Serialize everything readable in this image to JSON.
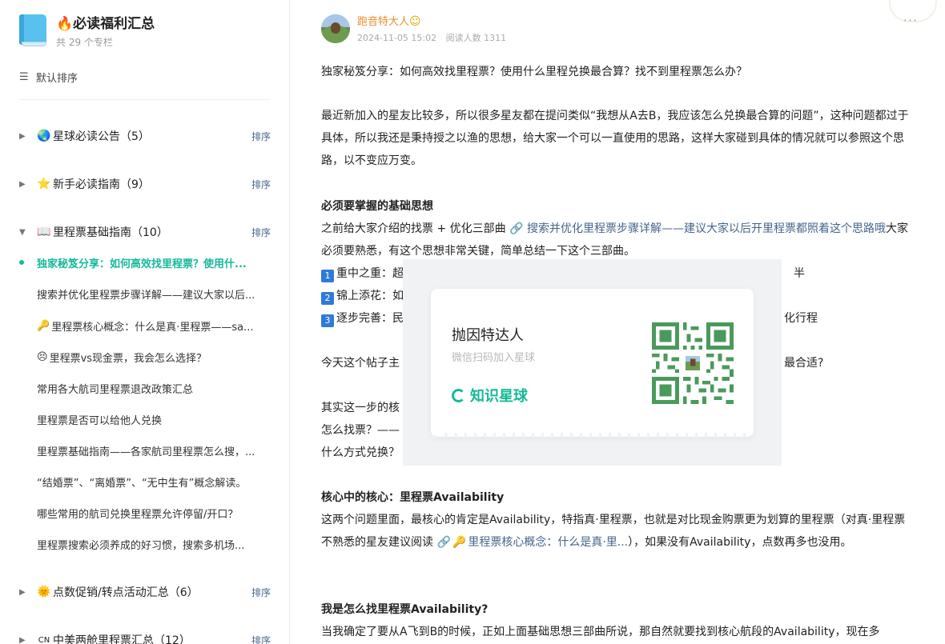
{
  "sidebar": {
    "column_title": "🔥必读福利汇总",
    "column_count": "共 29 个专栏",
    "sort_label": "默认排序",
    "sections": [
      {
        "emoji": "🌏",
        "label": "星球必读公告（5）",
        "sort": "排序",
        "expanded": false
      },
      {
        "emoji": "⭐",
        "label": "新手必读指南（9）",
        "sort": "排序",
        "expanded": false
      },
      {
        "emoji": "📖",
        "label": "里程票基础指南（10）",
        "sort": "排序",
        "expanded": true
      },
      {
        "emoji": "🌞",
        "label": "点数促销/转点活动汇总（6）",
        "sort": "排序",
        "expanded": false
      },
      {
        "emoji": "CN",
        "label": "中美两舱里程票汇总（12）",
        "sort": "排序",
        "expanded": false
      }
    ],
    "sub_items": [
      {
        "emoji": "",
        "label": "独家秘笈分享：如何高效找里程票？使用什...",
        "active": true
      },
      {
        "emoji": "",
        "label": "搜索并优化里程票步骤详解——建议大家以后...",
        "active": false
      },
      {
        "emoji": "🔑",
        "label": "里程票核心概念：什么是真·里程票——sa...",
        "active": false
      },
      {
        "emoji": "😣",
        "label": "里程票vs现金票，我会怎么选择？",
        "active": false
      },
      {
        "emoji": "",
        "label": "常用各大航司里程票退改政策汇总",
        "active": false
      },
      {
        "emoji": "",
        "label": "里程票是否可以给他人兑换",
        "active": false
      },
      {
        "emoji": "",
        "label": "里程票基础指南——各家航司里程票怎么搜，...",
        "active": false
      },
      {
        "emoji": "",
        "label": "“结婚票”、“离婚票”、“无中生有”概念解读。",
        "active": false
      },
      {
        "emoji": "",
        "label": "哪些常用的航司兑换里程票允许停留/开口？",
        "active": false
      },
      {
        "emoji": "",
        "label": "里程票搜索必须养成的好习惯，搜索多机场...",
        "active": false
      }
    ]
  },
  "post": {
    "author_name": "跑音特大人",
    "author_emoji": "☺",
    "date": "2024-11-05 15:02",
    "read_count": "阅读人数 1311",
    "more": "···",
    "p1": "独家秘笈分享：如何高效找里程票？使用什么里程兑换最合算？找不到里程票怎么办？",
    "p2": "最近新加入的星友比较多，所以很多星友都在提问类似“我想从A去B，我应该怎么兑换最合算的问题”，这种问题都过于具体，所以我还是秉持授之以渔的思想，给大家一个可以一直使用的思路，这样大家碰到具体的情况就可以参照这个思路，以不变应万变。",
    "h1": "必须要掌握的基础思想",
    "p3_a": "之前给大家介绍的找票 + 优化三部曲 ",
    "p3_link": "🔗 搜索并优化里程票步骤详解——建议大家以后开里程票都照着这个思路哦",
    "p3_b": "大家必须要熟悉，有这个思想非常关键，简单总结一下这个三部曲。",
    "step1_num": "1",
    "step1": "重中之重：超",
    "step1_tail": "半",
    "step2_num": "2",
    "step2": "锦上添花：如",
    "step3_num": "3",
    "step3": "逐步完善：民",
    "step3_tail": "化行程",
    "p4": "今天这个帖子主",
    "p4_tail": "最合适?",
    "p5_a": "其实这一步的核",
    "p5_b": "怎么找票？——",
    "p5_c": "什么方式兑换？",
    "h2": "核心中的核心：里程票Availability",
    "p6_a": "这两个问题里面，最核心的肯定是Availability，特指真·里程票，也就是对比现金购票更为划算的里程票（对真·里程票不熟悉的星友建议阅读 ",
    "p6_link_icon": "🔗",
    "p6_key": "🔑",
    "p6_link": "里程票核心概念：什么是真·里...",
    "p6_b": "），如果没有Availability，点数再多也没用。",
    "h3": "我是怎么找里程票Availability?",
    "p7": "当我确定了要从A飞到B的时候，正如上面基础思想三部曲所说，那自然就要找到核心航段的Availability，现在多"
  },
  "qr_card": {
    "name": "抛因特达人",
    "hint": "微信扫码加入星球",
    "logo_text": "知识星球"
  },
  "colors": {
    "accent_green": "#16b998",
    "link_blue": "#46658d",
    "author_orange": "#e98d2e",
    "qr_green": "#4a9a5c"
  }
}
